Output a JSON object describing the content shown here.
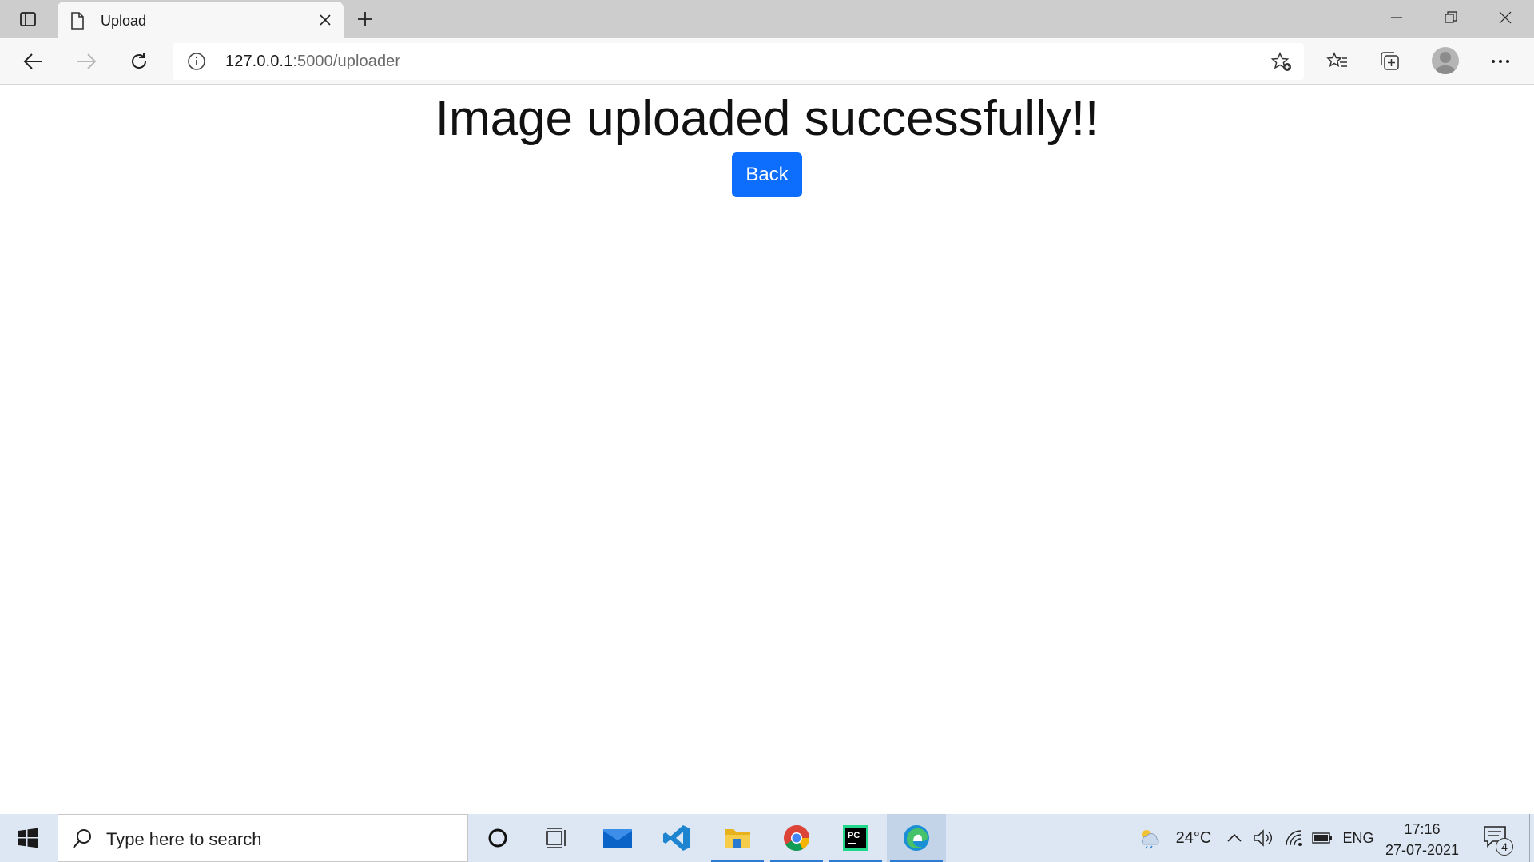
{
  "browser": {
    "tab": {
      "title": "Upload"
    },
    "address": {
      "host": "127.0.0.1",
      "path": ":5000/uploader"
    }
  },
  "page": {
    "heading": "Image uploaded successfully!!",
    "back_button": "Back"
  },
  "taskbar": {
    "search_placeholder": "Type here to search",
    "weather_temp": "24°C",
    "language": "ENG",
    "time": "17:16",
    "date": "27-07-2021",
    "notification_count": "4"
  },
  "colors": {
    "primary_button": "#0d6efd",
    "taskbar_bg": "#dde7f3",
    "tabstrip_bg": "#cdcdcd"
  },
  "icons": {
    "tab_actions": "tab-actions-icon",
    "favicon": "page-icon",
    "tab_close": "close-icon",
    "new_tab": "plus-icon",
    "back": "arrow-left-icon",
    "forward": "arrow-right-icon",
    "refresh": "refresh-icon",
    "info": "info-icon",
    "add_favorite": "star-add-icon",
    "favorites": "favorites-icon",
    "collections": "collections-icon",
    "profile": "profile-icon",
    "more": "more-icon"
  }
}
